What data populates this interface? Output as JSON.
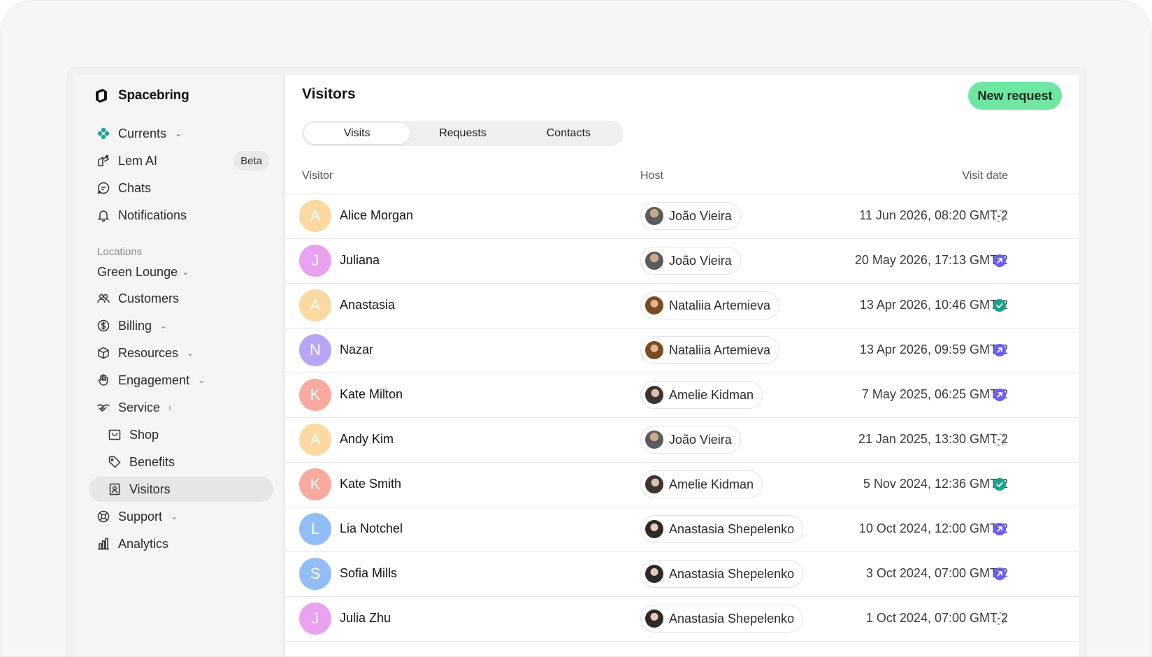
{
  "brand": {
    "name": "Spacebring"
  },
  "sidebar": {
    "items": [
      {
        "label": "Currents",
        "icon": "currents-icon",
        "chevron": "⌄"
      },
      {
        "label": "Lem AI",
        "icon": "lem-ai-icon",
        "badge": "Beta"
      },
      {
        "label": "Chats",
        "icon": "chat-icon"
      },
      {
        "label": "Notifications",
        "icon": "bell-icon"
      }
    ],
    "section_label": "Locations",
    "location": {
      "label": "Green Lounge",
      "chevron": "⌄"
    },
    "location_items": [
      {
        "label": "Customers",
        "icon": "users-icon"
      },
      {
        "label": "Billing",
        "icon": "dollar-icon",
        "chevron": "⌄"
      },
      {
        "label": "Resources",
        "icon": "cube-icon",
        "chevron": "⌄"
      },
      {
        "label": "Engagement",
        "icon": "hand-wave-icon",
        "chevron": "⌄"
      },
      {
        "label": "Service",
        "icon": "handshake-icon",
        "chevron": "›"
      },
      {
        "label": "Shop",
        "icon": "shop-icon"
      },
      {
        "label": "Benefits",
        "icon": "tag-icon"
      },
      {
        "label": "Visitors",
        "icon": "badge-icon",
        "active": true
      },
      {
        "label": "Support",
        "icon": "lifebuoy-icon",
        "chevron": "⌄"
      },
      {
        "label": "Analytics",
        "icon": "bar-chart-icon"
      }
    ]
  },
  "main": {
    "title": "Visitors",
    "new_request_label": "New request",
    "tabs": [
      {
        "label": "Visits",
        "active": true
      },
      {
        "label": "Requests"
      },
      {
        "label": "Contacts"
      }
    ],
    "columns": {
      "visitor": "Visitor",
      "host": "Host",
      "visit_date": "Visit date"
    },
    "status_colors": {
      "pending": "#9a9a9a",
      "upcoming": "#6b5cf6",
      "completed": "#14a38b"
    },
    "rows": [
      {
        "initial": "A",
        "avatar_color": "#fcd9a0",
        "visitor": "Alice Morgan",
        "host": "João Vieira",
        "date": "11 Jun 2026, 08:20 GMT-2",
        "status": "pending"
      },
      {
        "initial": "J",
        "avatar_color": "#eaa2f0",
        "visitor": "Juliana",
        "host": "João Vieira",
        "date": "20 May 2026, 17:13 GMT-2",
        "status": "upcoming"
      },
      {
        "initial": "A",
        "avatar_color": "#fcd9a0",
        "visitor": "Anastasia",
        "host": "Nataliia Artemieva",
        "date": "13 Apr 2026, 10:46 GMT-2",
        "status": "completed"
      },
      {
        "initial": "N",
        "avatar_color": "#b8a6f5",
        "visitor": "Nazar",
        "host": "Nataliia Artemieva",
        "date": "13 Apr 2026, 09:59 GMT-2",
        "status": "upcoming"
      },
      {
        "initial": "K",
        "avatar_color": "#f8aaa0",
        "visitor": "Kate Milton",
        "host": "Amelie Kidman",
        "date": "7 May 2025, 06:25 GMT-2",
        "status": "upcoming"
      },
      {
        "initial": "A",
        "avatar_color": "#fcd9a0",
        "visitor": "Andy Kim",
        "host": "João Vieira",
        "date": "21 Jan 2025, 13:30 GMT-2",
        "status": "pending"
      },
      {
        "initial": "K",
        "avatar_color": "#f8aaa0",
        "visitor": "Kate Smith",
        "host": "Amelie Kidman",
        "date": "5 Nov 2024, 12:36 GMT-2",
        "status": "completed"
      },
      {
        "initial": "L",
        "avatar_color": "#93bdf6",
        "visitor": "Lia Notchel",
        "host": "Anastasia Shepelenko",
        "date": "10 Oct 2024, 12:00 GMT-2",
        "status": "upcoming"
      },
      {
        "initial": "S",
        "avatar_color": "#93bdf6",
        "visitor": "Sofia Mills",
        "host": "Anastasia Shepelenko",
        "date": "3 Oct 2024, 07:00 GMT-2",
        "status": "upcoming"
      },
      {
        "initial": "J",
        "avatar_color": "#eaa2f0",
        "visitor": "Julia Zhu",
        "host": "Anastasia Shepelenko",
        "date": "1 Oct 2024, 07:00 GMT-2",
        "status": "pending"
      }
    ]
  }
}
